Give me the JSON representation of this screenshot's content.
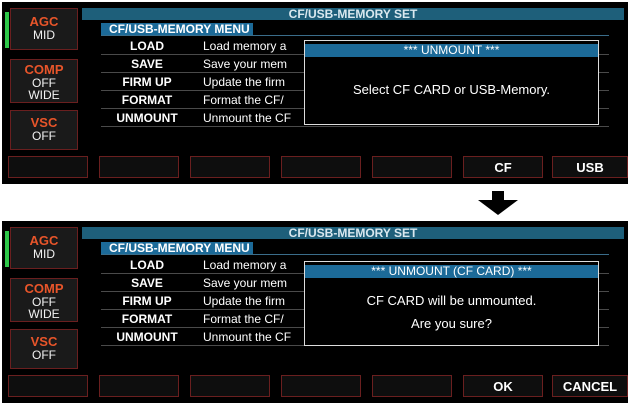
{
  "screens": [
    {
      "title": "CF/USB-MEMORY SET",
      "side": [
        {
          "title": "AGC",
          "values": [
            "MID"
          ]
        },
        {
          "title": "COMP",
          "values": [
            "OFF",
            "WIDE"
          ]
        },
        {
          "title": "VSC",
          "values": [
            "OFF"
          ]
        }
      ],
      "menu_label": "CF/USB-MEMORY MENU",
      "rows": [
        {
          "name": "LOAD",
          "desc": "Load memory a"
        },
        {
          "name": "SAVE",
          "desc": "Save your mem"
        },
        {
          "name": "FIRM UP",
          "desc": "Update the firm"
        },
        {
          "name": "FORMAT",
          "desc": "Format the CF/"
        },
        {
          "name": "UNMOUNT",
          "desc": "Unmount the CF"
        }
      ],
      "dialog": {
        "title": "*** UNMOUNT ***",
        "lines": [
          "Select CF CARD or USB-Memory.",
          ""
        ]
      },
      "keys": [
        "",
        "",
        "",
        "",
        "",
        "CF",
        "USB"
      ]
    },
    {
      "title": "CF/USB-MEMORY SET",
      "side": [
        {
          "title": "AGC",
          "values": [
            "MID"
          ]
        },
        {
          "title": "COMP",
          "values": [
            "OFF",
            "WIDE"
          ]
        },
        {
          "title": "VSC",
          "values": [
            "OFF"
          ]
        }
      ],
      "menu_label": "CF/USB-MEMORY MENU",
      "rows": [
        {
          "name": "LOAD",
          "desc": "Load memory a"
        },
        {
          "name": "SAVE",
          "desc": "Save your mem"
        },
        {
          "name": "FIRM UP",
          "desc": "Update the firm"
        },
        {
          "name": "FORMAT",
          "desc": "Format the CF/"
        },
        {
          "name": "UNMOUNT",
          "desc": "Unmount the CF"
        }
      ],
      "dialog": {
        "title": "*** UNMOUNT (CF CARD) ***",
        "lines": [
          "CF CARD will be unmounted.",
          "Are you sure?"
        ]
      },
      "keys": [
        "",
        "",
        "",
        "",
        "",
        "OK",
        "CANCEL"
      ]
    }
  ],
  "transition_icon": "down-arrow-icon"
}
